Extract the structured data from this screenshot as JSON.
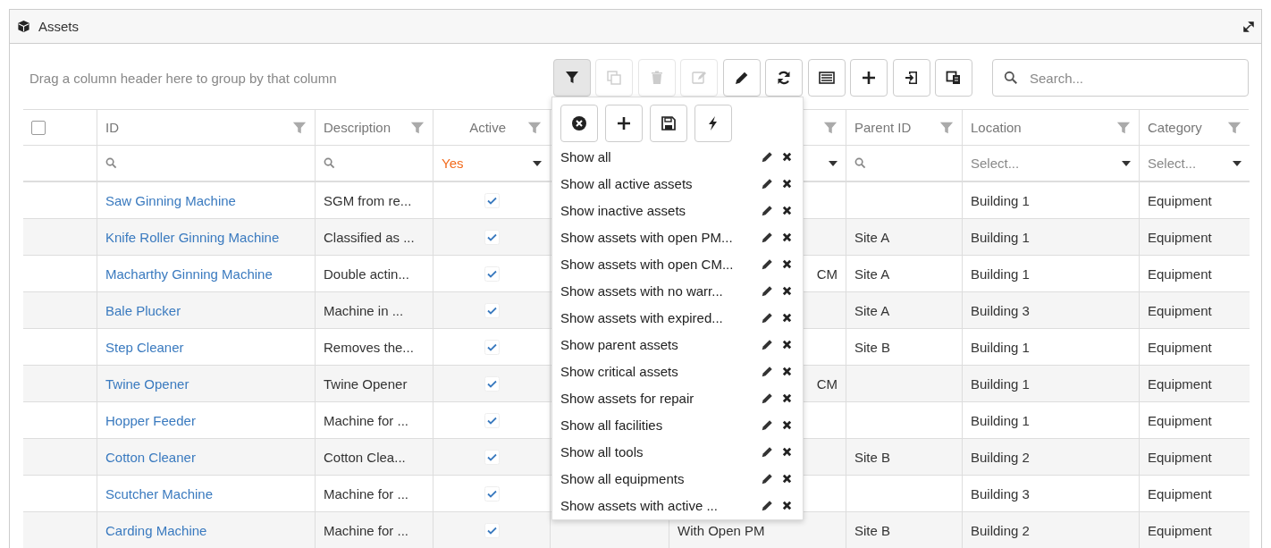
{
  "panel": {
    "title": "Assets"
  },
  "group_hint": "Drag a column header here to group by that column",
  "toolbar": [
    {
      "kind": "filter",
      "selected": true,
      "disabled": false
    },
    {
      "kind": "copy",
      "selected": false,
      "disabled": true
    },
    {
      "kind": "trash",
      "selected": false,
      "disabled": true
    },
    {
      "kind": "edit",
      "selected": false,
      "disabled": true
    },
    {
      "kind": "pencil",
      "selected": false,
      "disabled": false
    },
    {
      "kind": "refresh",
      "selected": false,
      "disabled": false
    },
    {
      "kind": "list",
      "selected": false,
      "disabled": false
    },
    {
      "kind": "plus",
      "selected": false,
      "disabled": false
    },
    {
      "kind": "import",
      "selected": false,
      "disabled": false
    },
    {
      "kind": "export",
      "selected": false,
      "disabled": false
    }
  ],
  "search": {
    "placeholder": "Search..."
  },
  "table": {
    "select_all": {
      "checked": false
    },
    "columns": [
      {
        "kind": "search",
        "label": "ID"
      },
      {
        "kind": "search",
        "label": "Description"
      },
      {
        "kind": "select",
        "label": "Active",
        "filter_value": "Yes"
      },
      {
        "kind": "covered"
      },
      {
        "kind": "select"
      },
      {
        "kind": "search",
        "label": "Parent ID"
      },
      {
        "kind": "select",
        "label": "Location",
        "placeholder": "Select..."
      },
      {
        "kind": "select",
        "label": "Category",
        "placeholder": "Select..."
      }
    ],
    "rows": [
      {
        "id": "Saw Ginning Machine",
        "description": "SGM from re...",
        "active": true,
        "location": "Building 1",
        "category": "Equipment"
      },
      {
        "id": "Knife Roller Ginning Machine",
        "description": "Classified as ...",
        "active": true,
        "parent_id": "Site A",
        "location": "Building 1",
        "category": "Equipment"
      },
      {
        "id": "Macharthy Ginning Machine",
        "description": "Double actin...",
        "active": true,
        "column_6": "CM",
        "column_6_cut": true,
        "parent_id": "Site A",
        "location": "Building 1",
        "category": "Equipment"
      },
      {
        "id": "Bale Plucker",
        "description": "Machine in ...",
        "active": true,
        "parent_id": "Site A",
        "location": "Building 3",
        "category": "Equipment"
      },
      {
        "id": "Step Cleaner",
        "description": "Removes the...",
        "active": true,
        "parent_id": "Site B",
        "location": "Building 1",
        "category": "Equipment"
      },
      {
        "id": "Twine Opener",
        "description": "Twine Opener",
        "active": true,
        "column_6": "CM",
        "column_6_cut": true,
        "location": "Building 1",
        "category": "Equipment"
      },
      {
        "id": "Hopper Feeder",
        "description": "Machine for ...",
        "active": true,
        "location": "Building 1",
        "category": "Equipment"
      },
      {
        "id": "Cotton Cleaner",
        "description": "Cotton Clea...",
        "active": true,
        "parent_id": "Site B",
        "location": "Building 2",
        "category": "Equipment"
      },
      {
        "id": "Scutcher Machine",
        "description": "Machine for ...",
        "active": true,
        "location": "Building 3",
        "category": "Equipment"
      },
      {
        "id": "Carding Machine",
        "description": "Machine for ...",
        "active": true,
        "column_6": "With Open PM",
        "parent_id": "Site B",
        "location": "Building 2",
        "category": "Equipment"
      }
    ]
  },
  "filter_menu": {
    "buttons": [
      {
        "kind": "clear"
      },
      {
        "kind": "plus"
      },
      {
        "kind": "save"
      },
      {
        "kind": "bolt"
      }
    ],
    "items": [
      {
        "label": "Show all"
      },
      {
        "label": "Show all active assets"
      },
      {
        "label": "Show inactive assets"
      },
      {
        "label": "Show assets with open PM..."
      },
      {
        "label": "Show assets with open CM..."
      },
      {
        "label": "Show assets with no warr..."
      },
      {
        "label": "Show assets with expired..."
      },
      {
        "label": "Show parent assets"
      },
      {
        "label": "Show critical assets"
      },
      {
        "label": "Show assets for repair"
      },
      {
        "label": "Show all facilities"
      },
      {
        "label": "Show all tools"
      },
      {
        "label": "Show all equipments"
      },
      {
        "label": "Show assets with active ..."
      }
    ]
  }
}
